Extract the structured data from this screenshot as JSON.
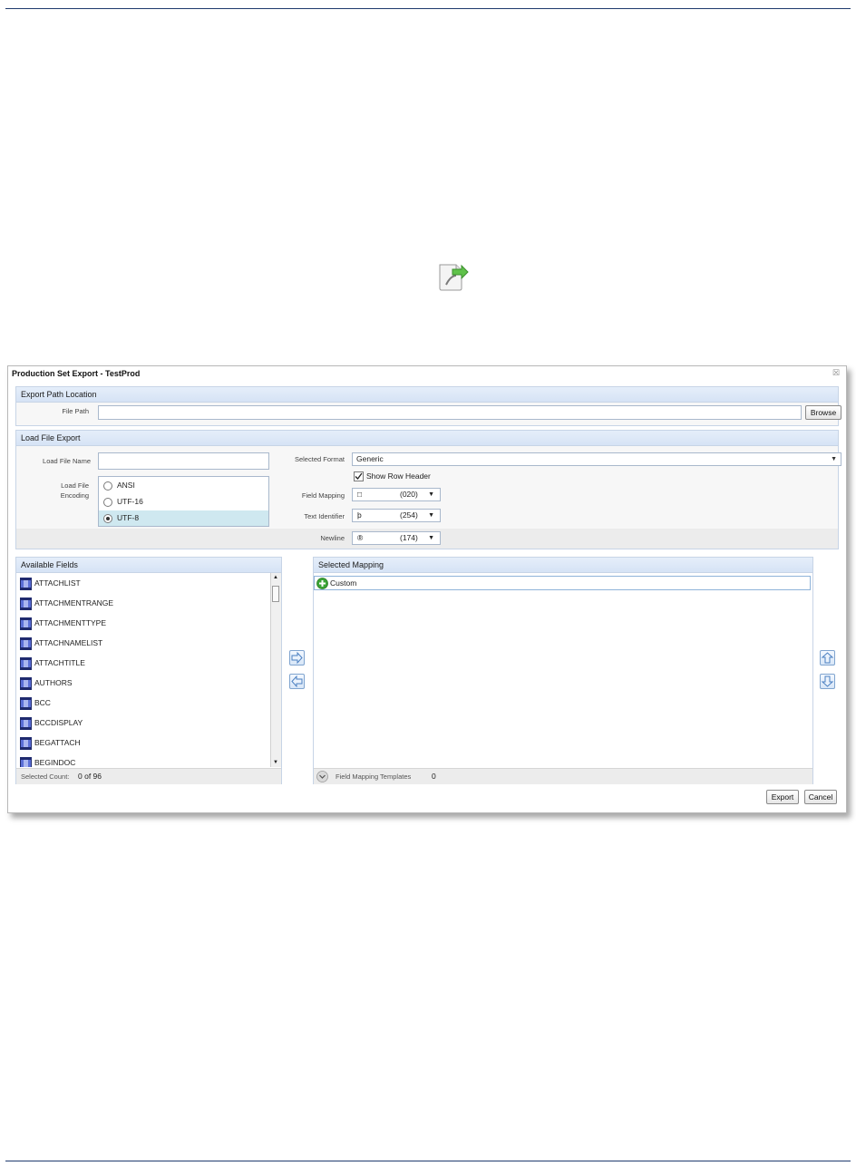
{
  "dialog": {
    "title": "Production Set Export - TestProd",
    "close_glyph": "☒"
  },
  "export_path": {
    "header": "Export Path Location",
    "file_path_label": "File Path",
    "file_path_value": "",
    "browse_label": "Browse"
  },
  "load_file": {
    "header": "Load File Export",
    "name_label": "Load File Name",
    "name_value": "",
    "encoding_label": "Load File Encoding",
    "encodings": [
      {
        "label": "ANSI",
        "selected": false
      },
      {
        "label": "UTF-16",
        "selected": false
      },
      {
        "label": "UTF-8",
        "selected": true
      }
    ],
    "selected_format_label": "Selected Format",
    "selected_format_value": "Generic",
    "show_row_header_label": "Show Row Header",
    "show_row_header_checked": true,
    "field_mapping_label": "Field Mapping",
    "field_mapping_glyph": "□",
    "field_mapping_code": "(020)",
    "text_identifier_label": "Text Identifier",
    "text_identifier_glyph": "þ",
    "text_identifier_code": "(254)",
    "newline_label": "Newline",
    "newline_glyph": "®",
    "newline_code": "(174)"
  },
  "available_fields": {
    "header": "Available Fields",
    "items": [
      "ATTACHLIST",
      "ATTACHMENTRANGE",
      "ATTACHMENTTYPE",
      "ATTACHNAMELIST",
      "ATTACHTITLE",
      "AUTHORS",
      "BCC",
      "BCCDISPLAY",
      "BEGATTACH",
      "BEGINDOC"
    ],
    "selected_count_label": "Selected Count:",
    "selected_count_value": "0 of 96"
  },
  "selected_mapping": {
    "header": "Selected Mapping",
    "items": [
      "Custom"
    ],
    "templates_label": "Field Mapping Templates",
    "templates_count": "0"
  },
  "footer": {
    "export_label": "Export",
    "cancel_label": "Cancel"
  },
  "colors": {
    "accent": "#1f3b6e",
    "panel_header": "#d6e3f5",
    "selection": "#cfe8f0",
    "field_icon": "#5b6fd6",
    "add_icon": "#3aa335"
  },
  "icons": {
    "page": "export-document-icon",
    "field": "field-icon",
    "add": "add-icon",
    "move_right": "move-right-arrow-icon",
    "move_left": "move-left-arrow-icon",
    "move_up": "move-up-arrow-icon",
    "move_down": "move-down-arrow-icon",
    "expand": "expand-chevron-icon",
    "check": "checkmark-icon"
  }
}
